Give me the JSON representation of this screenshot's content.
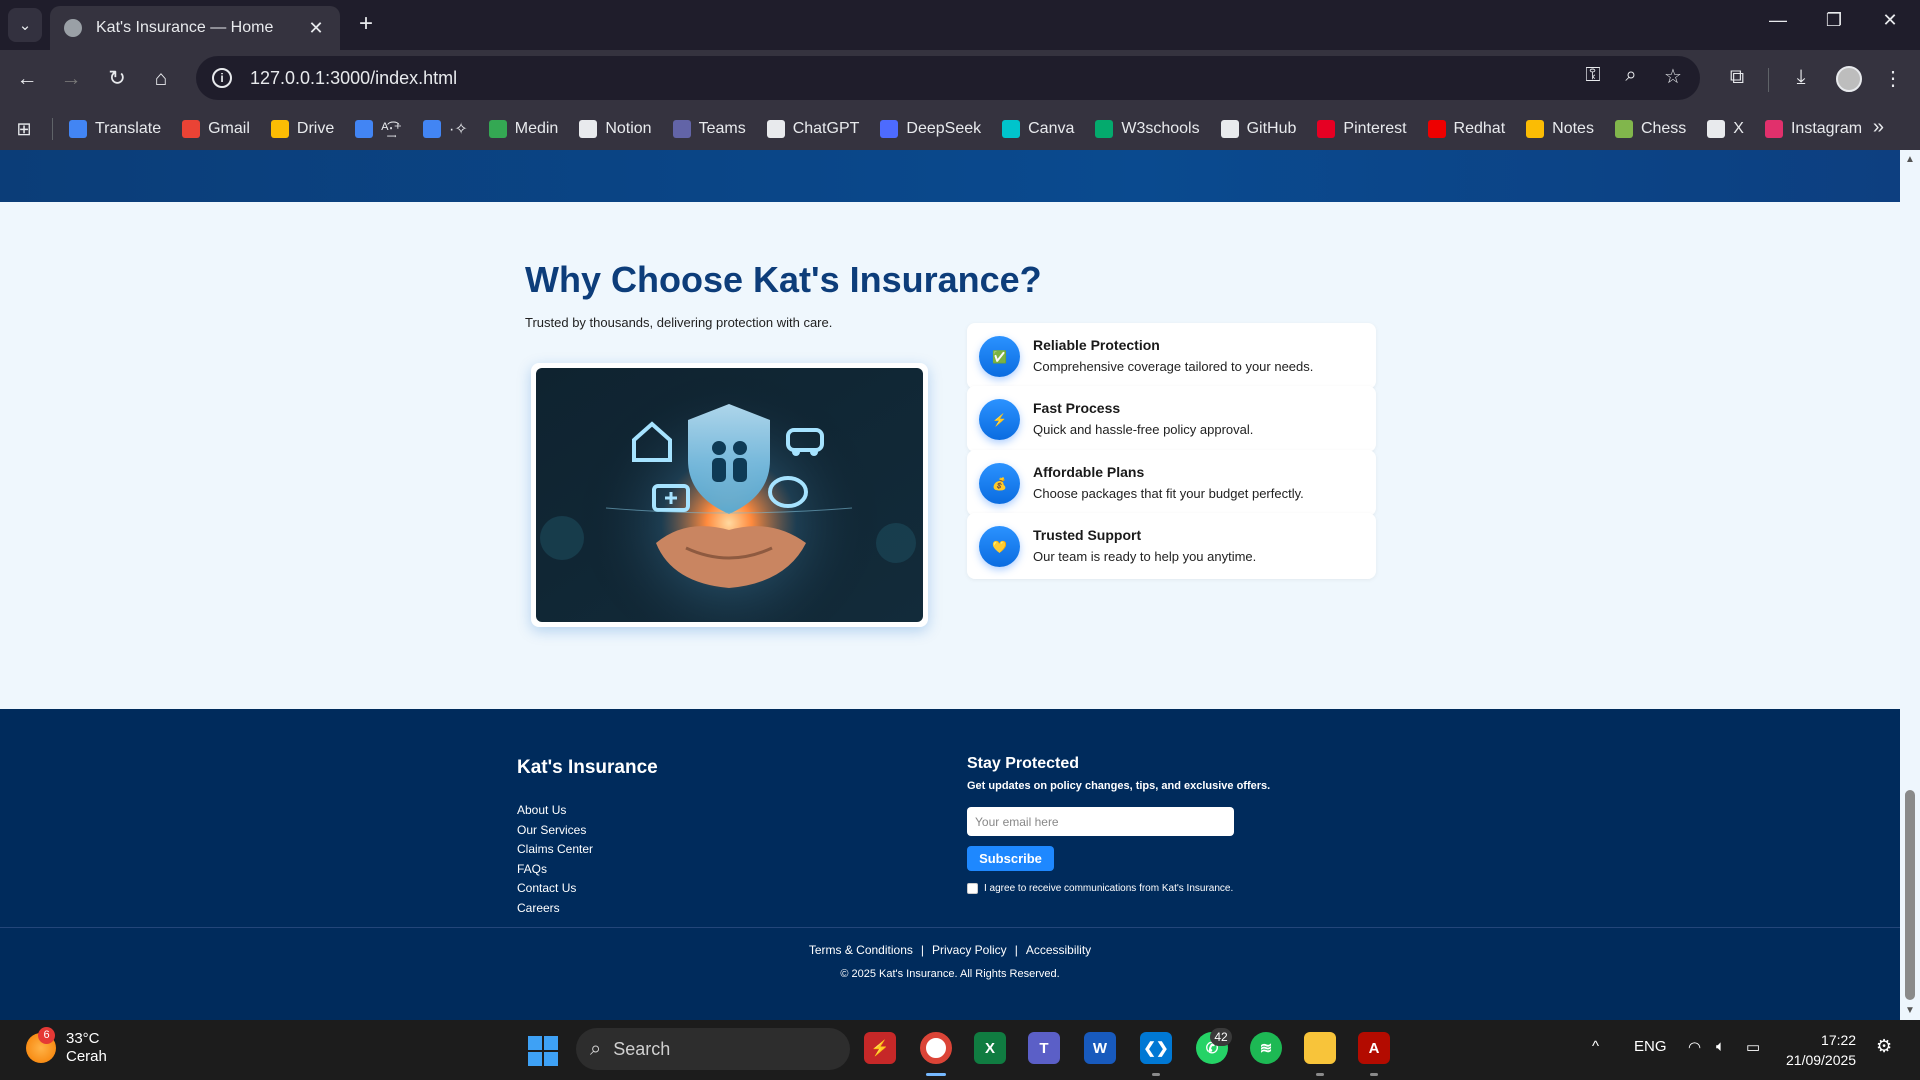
{
  "browser": {
    "tab_title": "Kat's Insurance — Home",
    "url": "127.0.0.1:3000/index.html",
    "bookmarks": [
      {
        "label": "Translate",
        "color": "#4285f4"
      },
      {
        "label": "Gmail",
        "color": "#ea4335"
      },
      {
        "label": "Drive",
        "color": "#fbbc04"
      },
      {
        "label": "ᴬ͢͡‧⁺",
        "color": "#4285f4"
      },
      {
        "label": "·✧",
        "color": "#4285f4"
      },
      {
        "label": "Medin",
        "color": "#34a853"
      },
      {
        "label": "Notion",
        "color": "#e8eaed"
      },
      {
        "label": "Teams",
        "color": "#6264a7"
      },
      {
        "label": "ChatGPT",
        "color": "#e8eaed"
      },
      {
        "label": "DeepSeek",
        "color": "#4d6bfe"
      },
      {
        "label": "Canva",
        "color": "#00c4cc"
      },
      {
        "label": "W3schools",
        "color": "#04aa6d"
      },
      {
        "label": "GitHub",
        "color": "#e8eaed"
      },
      {
        "label": "Pinterest",
        "color": "#e60023"
      },
      {
        "label": "Redhat",
        "color": "#ee0000"
      },
      {
        "label": "Notes",
        "color": "#fbbc04"
      },
      {
        "label": "Chess",
        "color": "#81b64c"
      },
      {
        "label": "X",
        "color": "#e8eaed"
      },
      {
        "label": "Instagram",
        "color": "#e1306c"
      }
    ]
  },
  "page": {
    "why": {
      "heading": "Why Choose Kat's Insurance?",
      "subheading": "Trusted by thousands, delivering protection with care.",
      "features": [
        {
          "title": "Reliable Protection",
          "desc": "Comprehensive coverage tailored to your needs.",
          "icon": "check-icon",
          "glyph": "✅"
        },
        {
          "title": "Fast Process",
          "desc": "Quick and hassle-free policy approval.",
          "icon": "lightning-icon",
          "glyph": "⚡"
        },
        {
          "title": "Affordable Plans",
          "desc": "Choose packages that fit your budget perfectly.",
          "icon": "money-bag-icon",
          "glyph": "💰"
        },
        {
          "title": "Trusted Support",
          "desc": "Our team is ready to help you anytime.",
          "icon": "heart-icon",
          "glyph": "💛"
        }
      ]
    },
    "footer": {
      "brand": "Kat's Insurance",
      "links": [
        "About Us",
        "Our Services",
        "Claims Center",
        "FAQs",
        "Contact Us",
        "Careers"
      ],
      "newsletter_title": "Stay Protected",
      "newsletter_sub": "Get updates on policy changes, tips, and exclusive offers.",
      "email_placeholder": "Your email here",
      "subscribe_label": "Subscribe",
      "consent": "I agree to receive communications from Kat's Insurance.",
      "legal": [
        "Terms & Conditions",
        "Privacy Policy",
        "Accessibility"
      ],
      "copyright": "© 2025 Kat's Insurance. All Rights Reserved."
    }
  },
  "taskbar": {
    "weather_temp": "33°C",
    "weather_cond": "Cerah",
    "weather_badge": "6",
    "search_label": "Search",
    "whatsapp_badge": "42",
    "lang": "ENG",
    "time": "17:22",
    "date": "21/09/2025"
  },
  "colors": {
    "primary": "#0d3d7a",
    "accent": "#1e88ff",
    "footer_bg": "#002b5c",
    "section_bg": "#eff7fd"
  }
}
